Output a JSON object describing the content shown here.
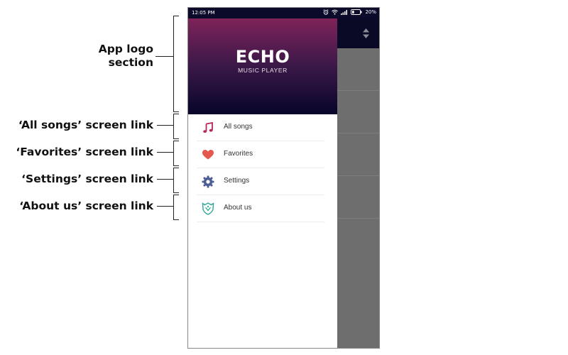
{
  "annotations": {
    "logo_section": [
      "App logo",
      "section"
    ],
    "all_songs": "‘All songs’ screen link",
    "favorites": "‘Favorites’ screen link",
    "settings": "‘Settings’ screen link",
    "about_us": "‘About us’ screen link"
  },
  "status_bar": {
    "time": "12:05 PM",
    "battery": "20%",
    "icons": [
      "alarm-icon",
      "wifi-icon",
      "signal-icon",
      "battery-icon"
    ]
  },
  "drawer": {
    "logo_title": "ECHO",
    "logo_subtitle": "MUSIC PLAYER",
    "items": [
      {
        "label": "All songs",
        "icon": "music-note-icon",
        "color": "#b8275c"
      },
      {
        "label": "Favorites",
        "icon": "heart-icon",
        "color": "#e4584e"
      },
      {
        "label": "Settings",
        "icon": "gear-icon",
        "color": "#4d5d95"
      },
      {
        "label": "About us",
        "icon": "shield-icon",
        "color": "#2fa79b"
      }
    ]
  },
  "colors": {
    "header_gradient_top": "#7f2359",
    "header_gradient_bottom": "#07052a",
    "scrim": "#6e6e6e"
  }
}
